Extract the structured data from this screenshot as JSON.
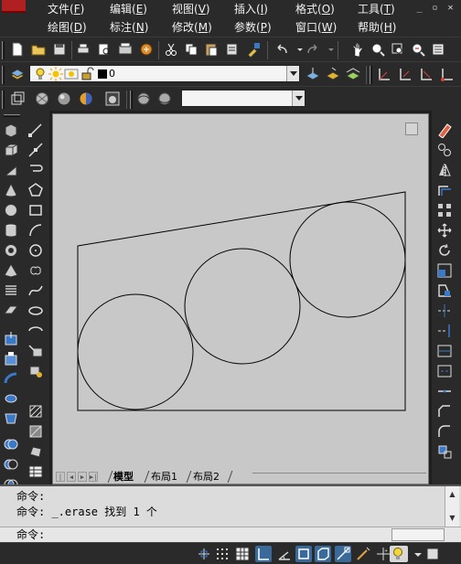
{
  "menu": {
    "row1": [
      {
        "label": "文件",
        "key": "F"
      },
      {
        "label": "编辑",
        "key": "E"
      },
      {
        "label": "视图",
        "key": "V"
      },
      {
        "label": "插入",
        "key": "I"
      },
      {
        "label": "格式",
        "key": "O"
      },
      {
        "label": "工具",
        "key": "T"
      }
    ],
    "row2": [
      {
        "label": "绘图",
        "key": "D"
      },
      {
        "label": "标注",
        "key": "N"
      },
      {
        "label": "修改",
        "key": "M"
      },
      {
        "label": "参数",
        "key": "P"
      },
      {
        "label": "窗口",
        "key": "W"
      },
      {
        "label": "帮助",
        "key": "H"
      }
    ]
  },
  "layer_bar": {
    "current_layer": "0"
  },
  "layout_tabs": [
    "模型",
    "布局1",
    "布局2"
  ],
  "active_tab": "模型",
  "command": {
    "history": [
      "命令:",
      "命令: _.erase 找到 1 个"
    ],
    "prompt": "命令:"
  },
  "colors": {
    "ui_dark": "#2a2a2a",
    "canvas_bg": "#c8c8c8",
    "command_bg": "#dcdcdc",
    "drawing_line": "#000000"
  }
}
